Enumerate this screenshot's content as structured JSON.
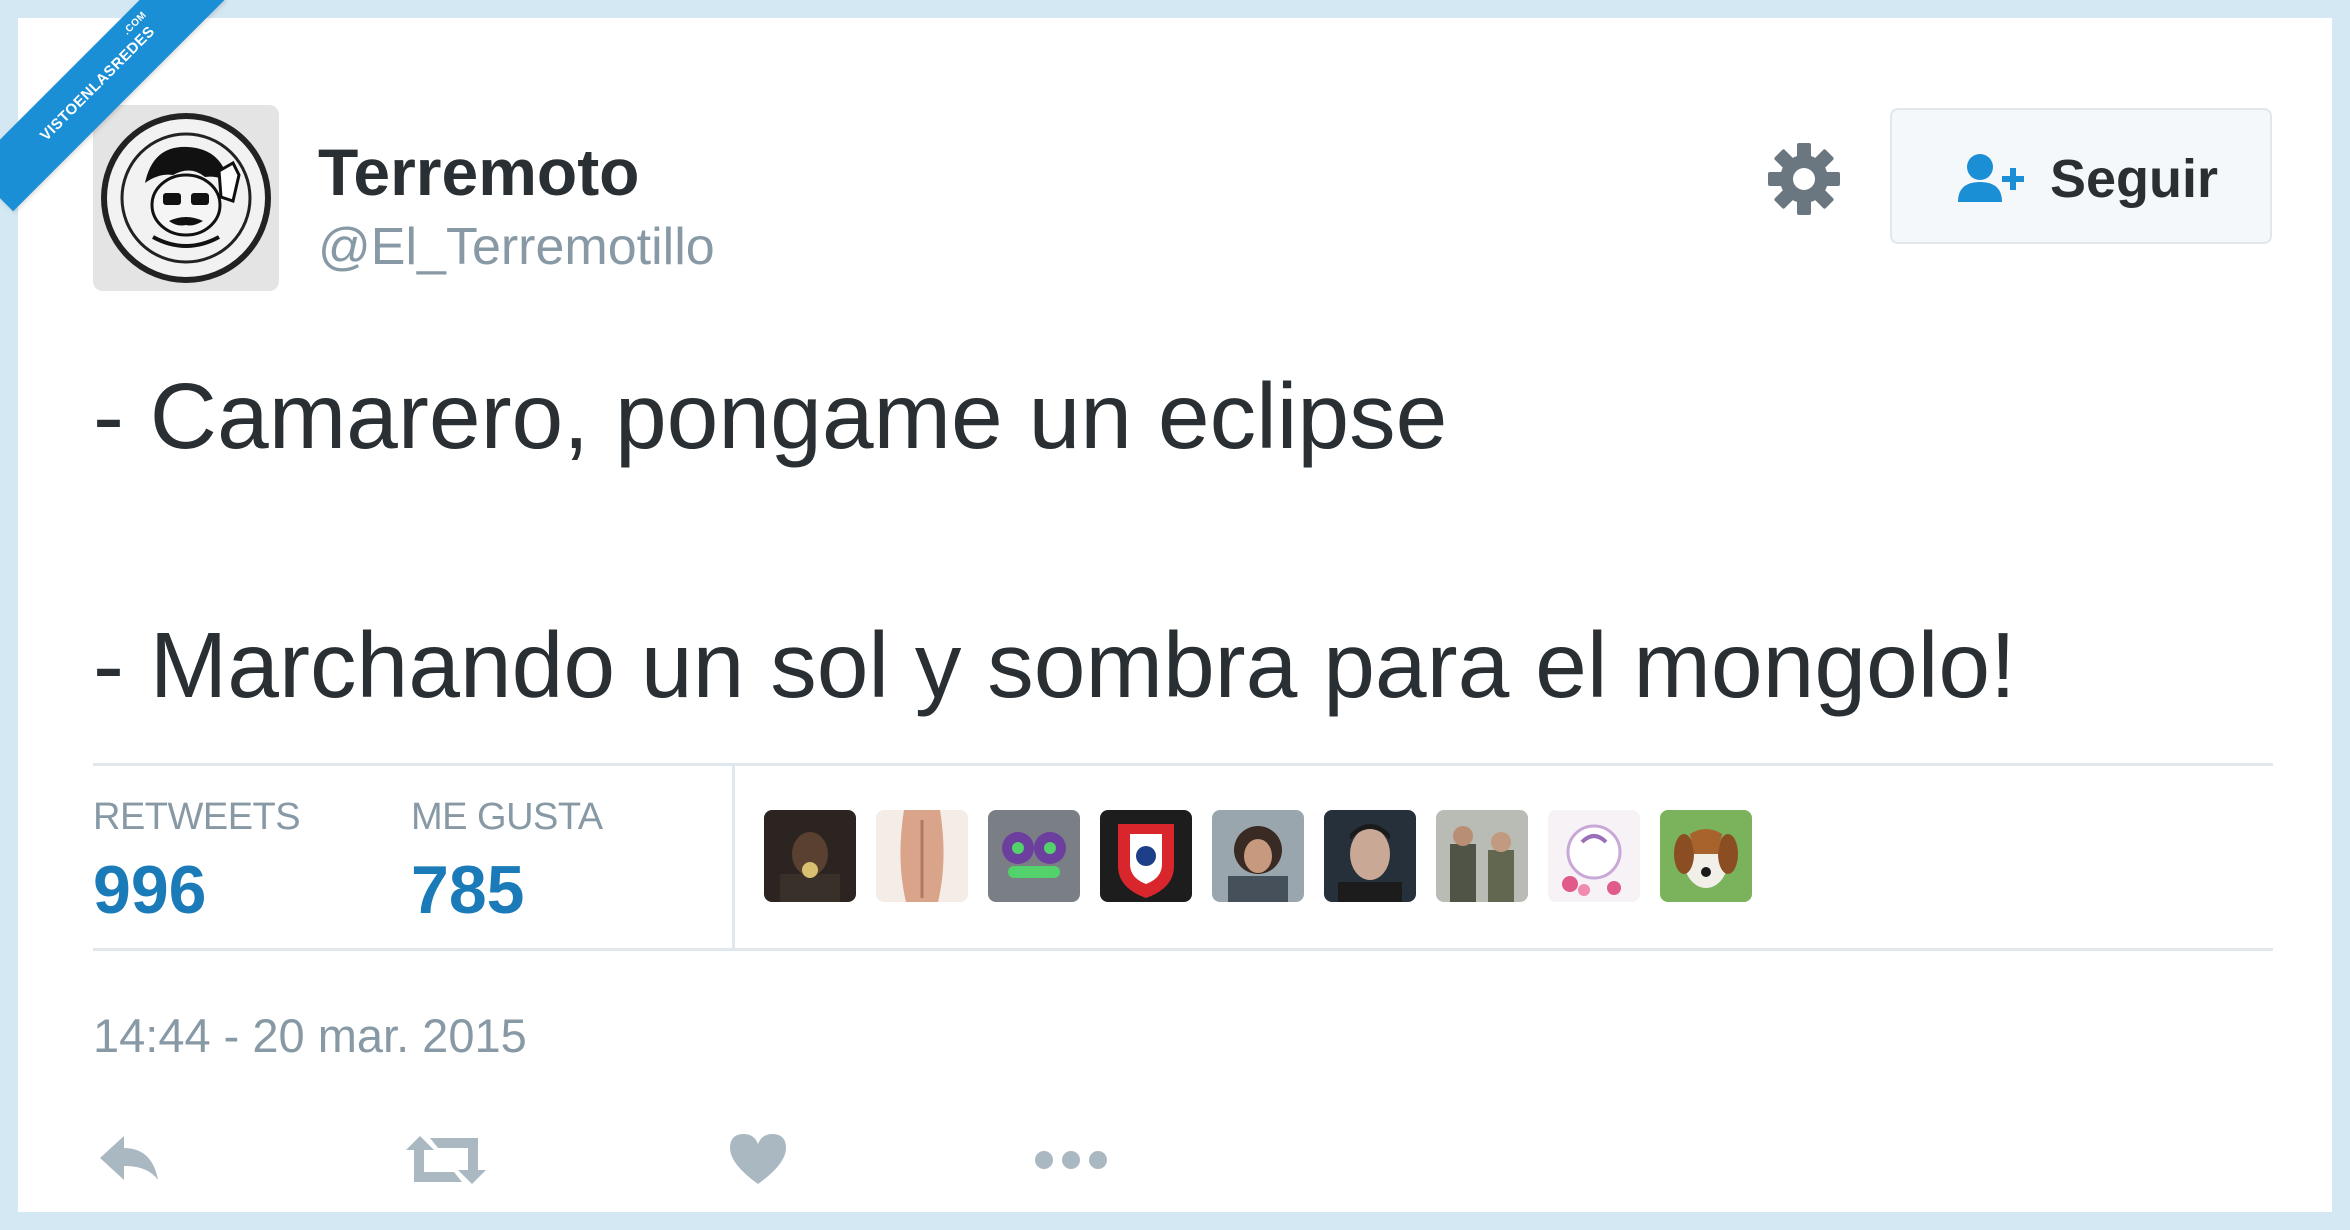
{
  "watermark": {
    "text": "VISTOENLASREDES",
    "suffix": ".COM"
  },
  "user": {
    "display_name": "Terremoto",
    "handle": "@El_Terremotillo"
  },
  "follow_button": {
    "label": "Seguir"
  },
  "tweet": {
    "lines": [
      "- Camarero, pongame un eclipse",
      "- Marchando un sol y sombra para el mongolo!"
    ]
  },
  "stats": {
    "retweets_label": "RETWEETS",
    "retweets_value": "996",
    "likes_label": "ME GUSTA",
    "likes_value": "785"
  },
  "timestamp": "14:44 - 20 mar. 2015",
  "colors": {
    "accent": "#1b7ab8",
    "follow_icon": "#1b8fd6",
    "muted": "#8899a6",
    "icon_gray": "#aab8c2"
  },
  "icons": {
    "settings": "gear-icon",
    "follow": "person-add-icon",
    "reply": "reply-icon",
    "retweet": "retweet-icon",
    "like": "heart-icon",
    "more": "more-icon"
  }
}
